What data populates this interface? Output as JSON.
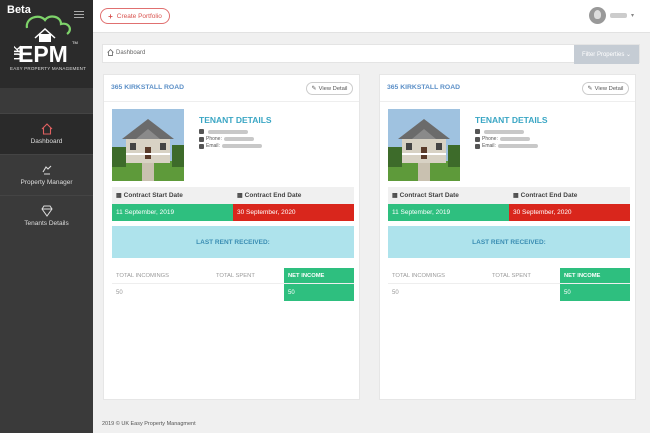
{
  "sidebar": {
    "beta_label": "Beta",
    "logo": {
      "uk": "UK",
      "epm": "EPM",
      "tm": "TM",
      "tagline": "EASY PROPERTY MANAGEMENT"
    },
    "items": [
      {
        "label": "Dashboard",
        "icon": "home-icon",
        "active": true
      },
      {
        "label": "Property Manager",
        "icon": "property-manager-icon",
        "active": false
      },
      {
        "label": "Tenants Details",
        "icon": "diamond-icon",
        "active": false
      }
    ]
  },
  "topbar": {
    "create_label": "Create Portfolio"
  },
  "breadcrumb": {
    "label": "Dashboard",
    "filter_label": "Filter Properties ⌄"
  },
  "cards": [
    {
      "title": "365 KIRKSTALL ROAD",
      "view_label": "View Detail",
      "tenant_title": "TENANT DETAILS",
      "phone_label": "Phone:",
      "email_label": "Email:",
      "start_header": "Contract Start Date",
      "end_header": "Contract End Date",
      "start_date": "11 September, 2019",
      "end_date": "30 September, 2020",
      "rent_label": "LAST RENT RECEIVED:",
      "incomings_header": "TOTAL INCOMINGS",
      "spent_header": "TOTAL SPENT",
      "net_header": "NET INCOME",
      "incomings_value": "50",
      "spent_value": "",
      "net_value": "50"
    },
    {
      "title": "365 KIRKSTALL ROAD",
      "view_label": "View Detail",
      "tenant_title": "TENANT DETAILS",
      "phone_label": "Phone:",
      "email_label": "Email:",
      "start_header": "Contract Start Date",
      "end_header": "Contract End Date",
      "start_date": "11 September, 2019",
      "end_date": "30 September, 2020",
      "rent_label": "LAST RENT RECEIVED:",
      "incomings_header": "TOTAL INCOMINGS",
      "spent_header": "TOTAL SPENT",
      "net_header": "NET INCOME",
      "incomings_value": "50",
      "spent_value": "",
      "net_value": "50"
    }
  ],
  "footer": "2019 © UK Easy Property Managment",
  "colors": {
    "accent_green": "#2ebf7f",
    "accent_red": "#d9261c",
    "accent_blue": "#3aa6c4",
    "sidebar_bg": "#3a3a3a"
  }
}
